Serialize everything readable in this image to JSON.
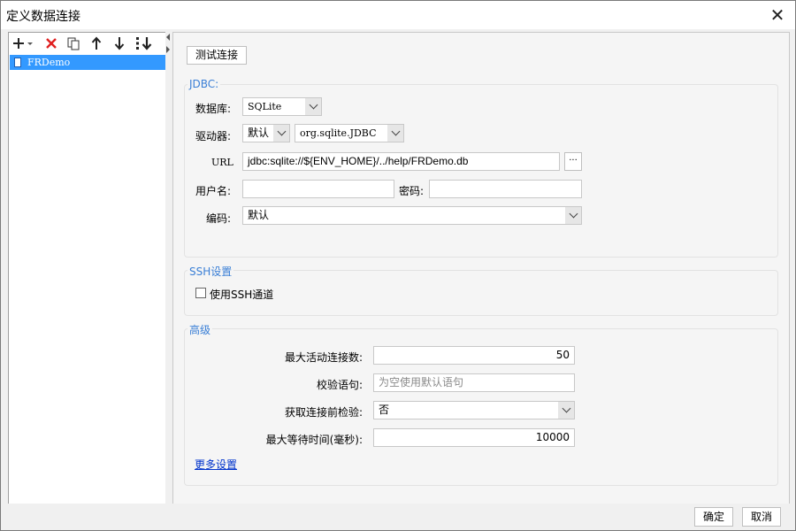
{
  "window": {
    "title": "定义数据连接"
  },
  "sidebar": {
    "items": [
      {
        "label": "FRDemo"
      }
    ]
  },
  "toolbar": {
    "icons": [
      "add-icon",
      "delete-icon",
      "copy-icon",
      "move-up-icon",
      "move-down-icon",
      "sort-icon"
    ]
  },
  "main": {
    "test_button": "测试连接",
    "jdbc": {
      "title": "JDBC:",
      "database_label": "数据库:",
      "database_value": "SQLite",
      "driver_label": "驱动器:",
      "driver_mode": "默认",
      "driver_class": "org.sqlite.JDBC",
      "url_label": "URL",
      "url_value": "jdbc:sqlite://${ENV_HOME}/../help/FRDemo.db",
      "browse_label": "···",
      "username_label": "用户名:",
      "username_value": "",
      "password_label": "密码:",
      "password_value": "",
      "encoding_label": "编码:",
      "encoding_value": "默认"
    },
    "ssh": {
      "title": "SSH设置",
      "use_ssh_label": "使用SSH通道",
      "use_ssh_checked": false
    },
    "advanced": {
      "title": "高级",
      "max_active_label": "最大活动连接数:",
      "max_active_value": "50",
      "validation_label": "校验语句:",
      "validation_placeholder": "为空使用默认语句",
      "test_before_label": "获取连接前检验:",
      "test_before_value": "否",
      "max_wait_label": "最大等待时间(毫秒):",
      "max_wait_value": "10000",
      "more_settings": "更多设置"
    }
  },
  "footer": {
    "ok": "确定",
    "cancel": "取消"
  },
  "colors": {
    "selection": "#3399ff",
    "group_title": "#3a7fd6",
    "delete": "#e02020",
    "link": "#0033cc"
  }
}
